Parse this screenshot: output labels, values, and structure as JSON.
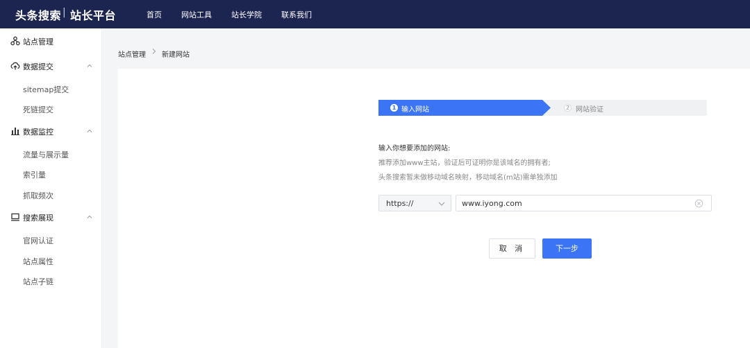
{
  "header": {
    "brand": "头条搜索",
    "separator": "|",
    "brand_sub": "站长平台",
    "nav": [
      "首页",
      "网站工具",
      "站长学院",
      "联系我们"
    ]
  },
  "sidebar": {
    "groups": [
      {
        "label": "站点管理",
        "icon": "sitemap-icon",
        "items": []
      },
      {
        "label": "数据提交",
        "icon": "cloud-upload-icon",
        "items": [
          "sitemap提交",
          "死链提交"
        ]
      },
      {
        "label": "数据监控",
        "icon": "bar-chart-icon",
        "items": [
          "流量与展示量",
          "索引量",
          "抓取频次"
        ]
      },
      {
        "label": "搜索展现",
        "icon": "monitor-icon",
        "items": [
          "官网认证",
          "站点属性",
          "站点子链"
        ]
      }
    ]
  },
  "breadcrumb": {
    "parent": "站点管理",
    "current": "新建网站"
  },
  "steps": [
    {
      "num": "1",
      "label": "输入网站",
      "active": true
    },
    {
      "num": "2",
      "label": "网站验证",
      "active": false
    }
  ],
  "form": {
    "title": "输入你想要添加的网站:",
    "hint1": "推荐添加www主站，验证后可证明你是该域名的拥有者;",
    "hint2": "头条搜索暂未做移动域名映射，移动域名(m站)需单独添加",
    "protocol": "https://",
    "url": "www.iyong.com"
  },
  "buttons": {
    "cancel": "取 消",
    "next": "下一步"
  },
  "colors": {
    "topbar": "#1c2550",
    "accent": "#3b74f4"
  }
}
